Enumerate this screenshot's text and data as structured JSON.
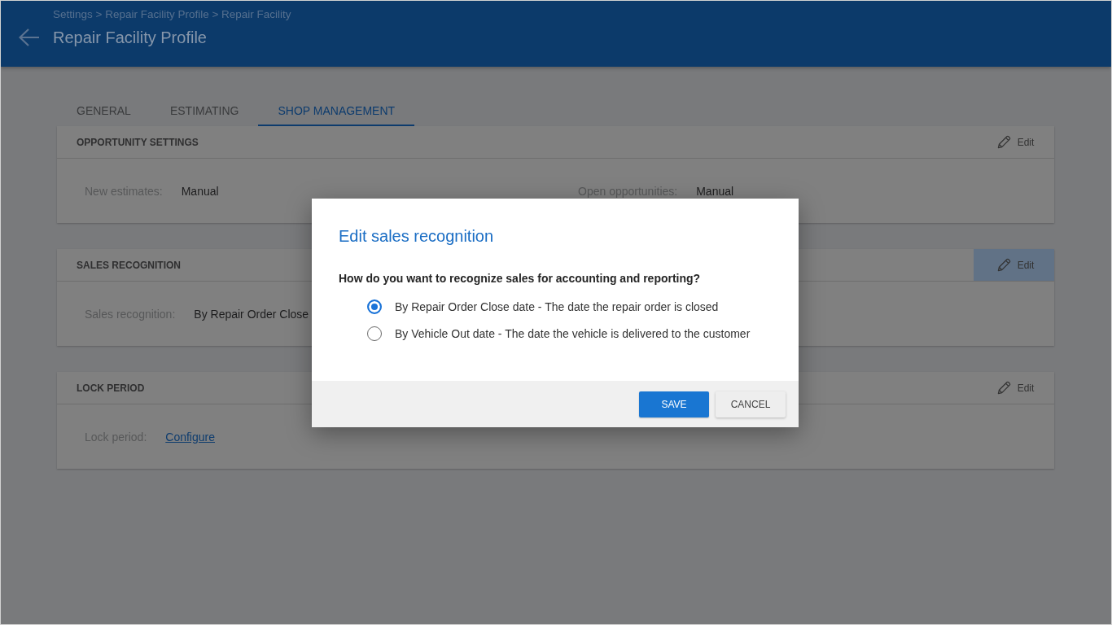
{
  "header": {
    "breadcrumb": "Settings > Repair Facility Profile > Repair Facility",
    "title": "Repair Facility Profile"
  },
  "tabs": [
    {
      "label": "GENERAL",
      "selected": false
    },
    {
      "label": "ESTIMATING",
      "selected": false
    },
    {
      "label": "SHOP MANAGEMENT",
      "selected": true
    }
  ],
  "sections": [
    {
      "title": "OPPORTUNITY SETTINGS",
      "edit": {
        "label": "Edit",
        "hovered": false
      },
      "fields": [
        {
          "kind": "text",
          "label": "New estimates:",
          "value": "Manual"
        },
        {
          "kind": "text",
          "label": "Open opportunities:",
          "value": "Manual"
        }
      ]
    },
    {
      "title": "SALES RECOGNITION",
      "edit": {
        "label": "Edit",
        "hovered": true
      },
      "fields": [
        {
          "kind": "text",
          "label": "Sales recognition:",
          "value": "By Repair Order Close"
        }
      ]
    },
    {
      "title": "LOCK PERIOD",
      "edit": {
        "label": "Edit",
        "hovered": false
      },
      "fields": [
        {
          "kind": "link",
          "label": "Lock period:",
          "value": "Configure"
        }
      ]
    }
  ],
  "dialog": {
    "title": "Edit sales recognition",
    "question": "How do you want to recognize sales for accounting and reporting?",
    "options": [
      {
        "label": "By Repair Order Close date - The date the repair order is closed",
        "selected": true
      },
      {
        "label": "By Vehicle Out date - The date the vehicle is delivered to the customer",
        "selected": false
      }
    ],
    "buttons": [
      {
        "kind": "primary",
        "label": "SAVE"
      },
      {
        "kind": "secondary",
        "label": "CANCEL"
      }
    ]
  }
}
